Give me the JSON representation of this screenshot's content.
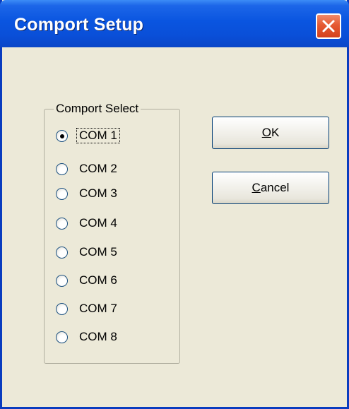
{
  "window": {
    "title": "Comport Setup"
  },
  "group": {
    "label": "Comport Select",
    "selected_index": 0,
    "options": [
      {
        "label": "COM 1"
      },
      {
        "label": "COM 2"
      },
      {
        "label": "COM 3"
      },
      {
        "label": "COM 4"
      },
      {
        "label": "COM 5"
      },
      {
        "label": "COM 6"
      },
      {
        "label": "COM 7"
      },
      {
        "label": "COM 8"
      }
    ]
  },
  "buttons": {
    "ok": {
      "mnemonic": "O",
      "rest": "K"
    },
    "cancel": {
      "mnemonic": "C",
      "rest": "ancel"
    }
  },
  "colors": {
    "titlebar": "#0a55e0",
    "dialog_bg": "#ece9d8",
    "close_button": "#e55a32"
  },
  "icons": {
    "close": "close-icon"
  }
}
